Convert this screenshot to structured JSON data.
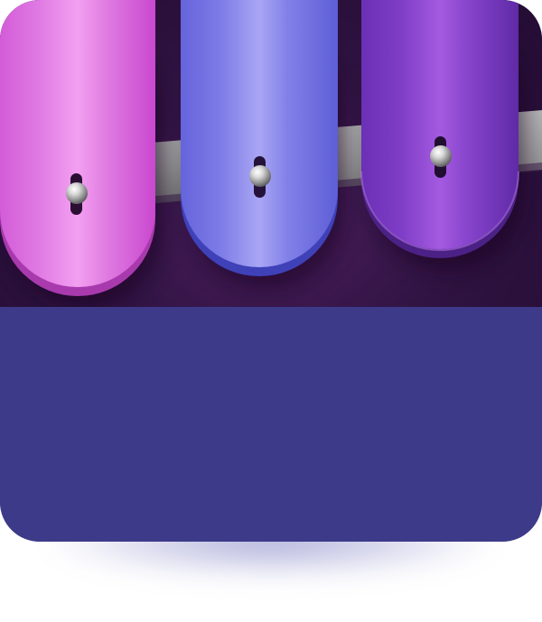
{
  "card": {
    "background_color": "#3d3a89",
    "artwork": {
      "subject": "glockenspiel-bars",
      "rail_color": "#a3a3a3",
      "bars": [
        {
          "name": "pink-bar",
          "color_light": "#f095ef",
          "color_base": "#d862dd",
          "color_dark": "#b23eb9"
        },
        {
          "name": "blue-bar",
          "color_light": "#a3a0f2",
          "color_base": "#6d6ce0",
          "color_dark": "#4a4cc4"
        },
        {
          "name": "violet-bar",
          "color_light": "#a758df",
          "color_base": "#7e3fc4",
          "color_dark": "#5a2a9c"
        }
      ],
      "pin_icon": "silver-pin-icon"
    }
  }
}
